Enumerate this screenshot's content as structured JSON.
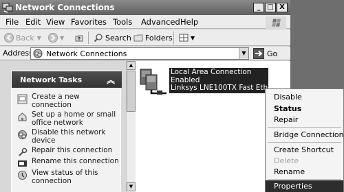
{
  "window": {
    "title": "Network Connections",
    "controls": {
      "minimize": "_",
      "maximize": "□",
      "close": "X"
    }
  },
  "menubar": {
    "items": [
      "File",
      "Edit",
      "View",
      "Favorites",
      "Tools",
      "Advanced",
      "Help"
    ]
  },
  "toolbar": {
    "back_label": "Back",
    "search_label": "Search",
    "folders_label": "Folders",
    "views_icon": "views-grid-icon"
  },
  "address": {
    "label": "Address",
    "value": "Network Connections",
    "go_label": "Go"
  },
  "tasks": {
    "header": "Network Tasks",
    "items": [
      {
        "label": "Create a new connection",
        "icon": "new-connection-icon"
      },
      {
        "label": "Set up a home or small office network",
        "icon": "home-network-icon"
      },
      {
        "label": "Disable this network device",
        "icon": "disable-network-icon"
      },
      {
        "label": "Repair this connection",
        "icon": "repair-wrench-icon"
      },
      {
        "label": "Rename this connection",
        "icon": "rename-icon"
      },
      {
        "label": "View status of this connection",
        "icon": "status-icon"
      }
    ]
  },
  "connection": {
    "name": "Local Area Connection",
    "status": "Enabled",
    "device": "Linksys LNE100TX Fast Ethern..."
  },
  "context_menu": {
    "items": [
      {
        "label": "Disable",
        "state": "normal"
      },
      {
        "label": "Status",
        "state": "default"
      },
      {
        "label": "Repair",
        "state": "normal"
      },
      {
        "label": "Bridge Connections",
        "state": "normal"
      },
      {
        "label": "Create Shortcut",
        "state": "normal"
      },
      {
        "label": "Delete",
        "state": "disabled"
      },
      {
        "label": "Rename",
        "state": "normal"
      },
      {
        "label": "Properties",
        "state": "selected"
      }
    ]
  },
  "colors": {
    "selection": "#2d2d2d",
    "task_header": "#3a3a3a",
    "desktop": "#6e6e6e"
  }
}
